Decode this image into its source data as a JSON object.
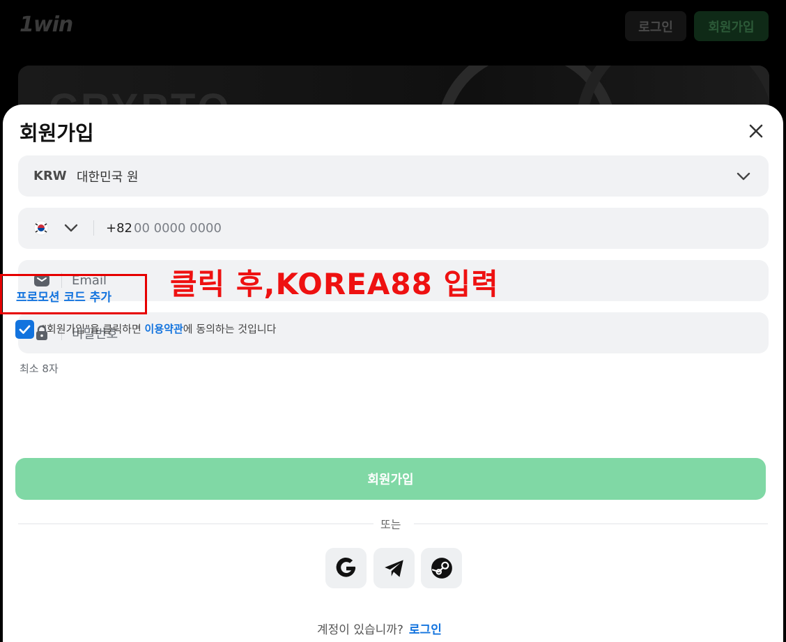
{
  "header": {
    "logo": "1win",
    "login_label": "로그인",
    "signup_label": "회원가입"
  },
  "banner": {
    "text": "CRYPTO"
  },
  "modal": {
    "title": "회원가입",
    "currency": {
      "code": "KRW",
      "name": "대한민국 원"
    },
    "phone": {
      "code": "+82",
      "placeholder": "00 0000 0000"
    },
    "email": {
      "placeholder": "Email"
    },
    "password": {
      "placeholder": "비밀번호",
      "hint": "최소 8자"
    },
    "promo_label": "프로모션 코드 추가",
    "terms": {
      "prefix": "\"회원가입\"을 클릭하면 ",
      "link": "이용약관",
      "suffix": "에 동의하는 것입니다",
      "checked": true
    },
    "submit_label": "회원가입",
    "divider": "또는",
    "social": [
      "google-icon",
      "telegram-icon",
      "steam-icon"
    ],
    "footer": {
      "text": "계정이 있습니까?",
      "link": "로그인"
    }
  },
  "annotation": "클릭 후,KOREA88 입력",
  "colors": {
    "accent_blue": "#1273de",
    "submit_green": "#80d8a5",
    "annotation_red": "#e60000",
    "field_bg": "#f1f2f4"
  }
}
